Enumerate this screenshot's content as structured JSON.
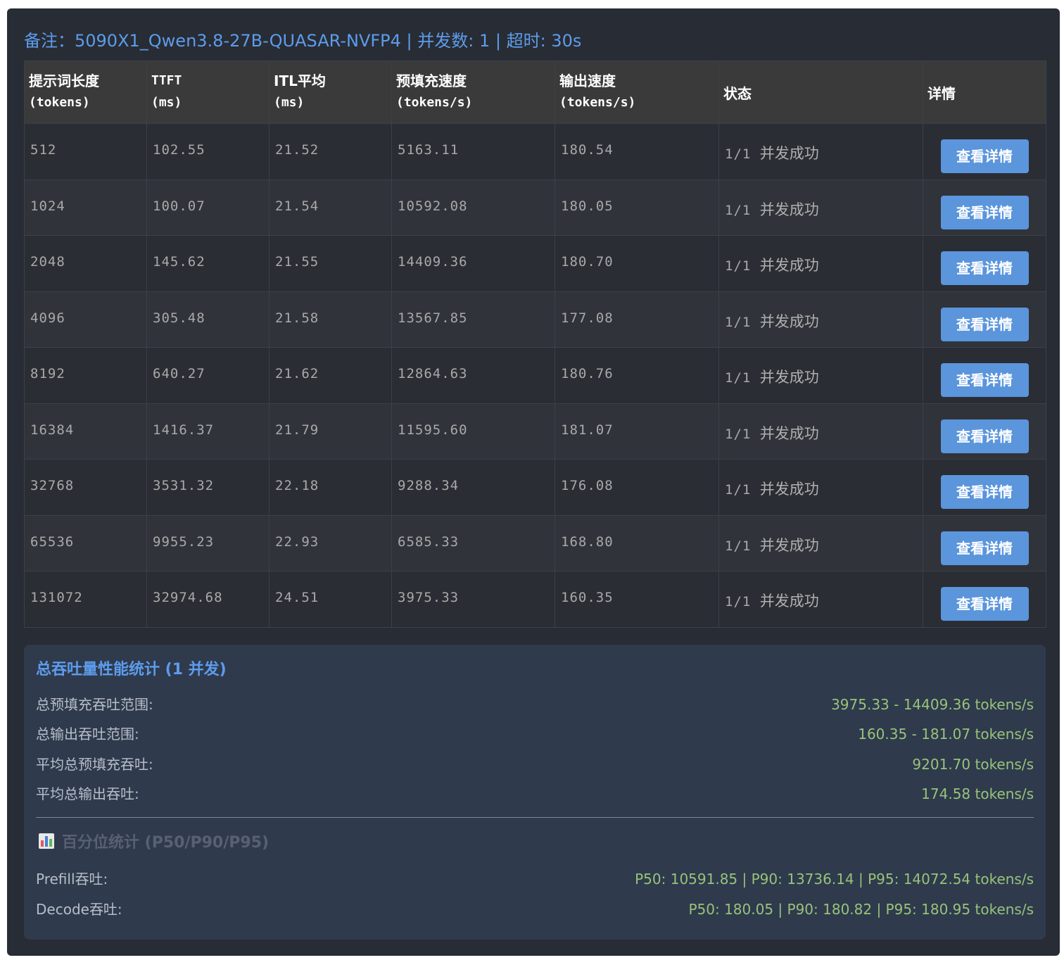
{
  "remark": "备注：5090X1_Qwen3.8-27B-QUASAR-NVFP4 | 并发数: 1 | 超时: 30s",
  "table": {
    "headers": [
      {
        "cn": "提示词长度",
        "unit": "(tokens)"
      },
      {
        "cn": "TTFT",
        "unit": "(ms)"
      },
      {
        "cn": "ITL平均",
        "unit": "(ms)"
      },
      {
        "cn": "预填充速度",
        "unit": "(tokens/s)"
      },
      {
        "cn": "输出速度",
        "unit": "(tokens/s)"
      },
      {
        "cn": "状态"
      },
      {
        "cn": "详情"
      }
    ],
    "rows": [
      {
        "prompt": "512",
        "ttft": "102.55",
        "itl": "21.52",
        "prefill": "5163.11",
        "output": "180.54",
        "status_num": "1/1",
        "status_text": "并发成功",
        "button": "查看详情"
      },
      {
        "prompt": "1024",
        "ttft": "100.07",
        "itl": "21.54",
        "prefill": "10592.08",
        "output": "180.05",
        "status_num": "1/1",
        "status_text": "并发成功",
        "button": "查看详情"
      },
      {
        "prompt": "2048",
        "ttft": "145.62",
        "itl": "21.55",
        "prefill": "14409.36",
        "output": "180.70",
        "status_num": "1/1",
        "status_text": "并发成功",
        "button": "查看详情"
      },
      {
        "prompt": "4096",
        "ttft": "305.48",
        "itl": "21.58",
        "prefill": "13567.85",
        "output": "177.08",
        "status_num": "1/1",
        "status_text": "并发成功",
        "button": "查看详情"
      },
      {
        "prompt": "8192",
        "ttft": "640.27",
        "itl": "21.62",
        "prefill": "12864.63",
        "output": "180.76",
        "status_num": "1/1",
        "status_text": "并发成功",
        "button": "查看详情"
      },
      {
        "prompt": "16384",
        "ttft": "1416.37",
        "itl": "21.79",
        "prefill": "11595.60",
        "output": "181.07",
        "status_num": "1/1",
        "status_text": "并发成功",
        "button": "查看详情"
      },
      {
        "prompt": "32768",
        "ttft": "3531.32",
        "itl": "22.18",
        "prefill": "9288.34",
        "output": "176.08",
        "status_num": "1/1",
        "status_text": "并发成功",
        "button": "查看详情"
      },
      {
        "prompt": "65536",
        "ttft": "9955.23",
        "itl": "22.93",
        "prefill": "6585.33",
        "output": "168.80",
        "status_num": "1/1",
        "status_text": "并发成功",
        "button": "查看详情"
      },
      {
        "prompt": "131072",
        "ttft": "32974.68",
        "itl": "24.51",
        "prefill": "3975.33",
        "output": "160.35",
        "status_num": "1/1",
        "status_text": "并发成功",
        "button": "查看详情"
      }
    ]
  },
  "stats": {
    "title": "总吞吐量性能统计 (1 并发)",
    "items": [
      {
        "label": "总预填充吞吐范围:",
        "value": "3975.33 - 14409.36 tokens/s"
      },
      {
        "label": "总输出吞吐范围:",
        "value": "160.35 - 181.07 tokens/s"
      },
      {
        "label": "平均总预填充吞吐:",
        "value": "9201.70 tokens/s"
      },
      {
        "label": "平均总输出吞吐:",
        "value": "174.58 tokens/s"
      }
    ],
    "percentile_title": "百分位统计 (P50/P90/P95)",
    "percentile_icon": "bar-chart-icon",
    "percentiles": [
      {
        "label": "Prefill吞吐:",
        "value": "P50: 10591.85 | P90: 13736.14 | P95: 14072.54 tokens/s"
      },
      {
        "label": "Decode吞吐:",
        "value": "P50: 180.05 | P90: 180.82 | P95: 180.95 tokens/s"
      }
    ]
  },
  "colors": {
    "accent": "#5d9cec",
    "value_green": "#98c379",
    "button": "#5b95dc",
    "panel_bg": "#282c34",
    "stats_bg": "#2f3a4d"
  }
}
